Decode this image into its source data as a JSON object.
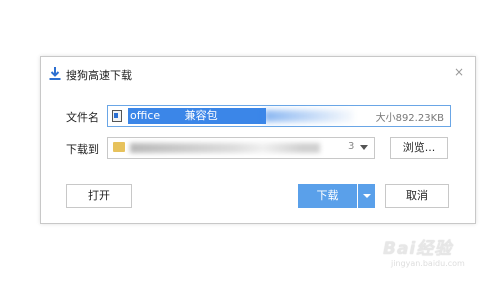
{
  "dialog": {
    "title": "搜狗高速下载",
    "close_glyph": "×"
  },
  "filename": {
    "label": "文件名",
    "value_visible": "office",
    "value_visible_tail": "兼容包",
    "size_text": "大小892.23KB"
  },
  "path": {
    "label": "下载到",
    "value_suffix": "3"
  },
  "buttons": {
    "browse": "浏览...",
    "open": "打开",
    "download": "下载",
    "cancel": "取消"
  },
  "watermark": {
    "logo_text": "Bai经验",
    "url": "jingyan.baidu.com"
  },
  "colors": {
    "accent": "#5aa0ea",
    "selection": "#3b86e8",
    "focus_border": "#6aa6e6",
    "title_icon": "#2c6fd1",
    "folder": "#e7c25c"
  },
  "icons": {
    "title": "download-arrow-icon",
    "file": "file-icon",
    "folder": "folder-icon",
    "path_dropdown": "chevron-down-icon",
    "download_dropdown": "chevron-down-icon",
    "close": "close-icon"
  }
}
